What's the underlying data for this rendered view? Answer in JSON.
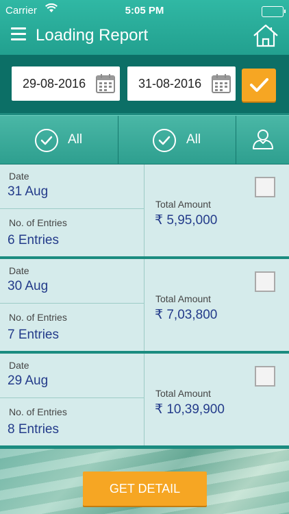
{
  "status": {
    "carrier": "Carrier",
    "time": "5:05 PM"
  },
  "header": {
    "title": "Loading Report",
    "menu_icon": "hamburger-icon",
    "home_icon": "home-icon"
  },
  "dates": {
    "from": "29-08-2016",
    "to": "31-08-2016"
  },
  "filters": [
    {
      "label": "All"
    },
    {
      "label": "All"
    }
  ],
  "labels": {
    "date": "Date",
    "entries": "No. of Entries",
    "total": "Total Amount"
  },
  "rows": [
    {
      "date": "31 Aug",
      "entries": "6 Entries",
      "amount": "₹ 5,95,000"
    },
    {
      "date": "30 Aug",
      "entries": "7 Entries",
      "amount": "₹ 7,03,800"
    },
    {
      "date": "29 Aug",
      "entries": "8 Entries",
      "amount": "₹ 10,39,900"
    }
  ],
  "actions": {
    "get_detail": "GET DETAIL"
  },
  "colors": {
    "header": "#22a08f",
    "date_bar": "#0c6f66",
    "accent": "#f6a623",
    "value_text": "#233b8a"
  }
}
